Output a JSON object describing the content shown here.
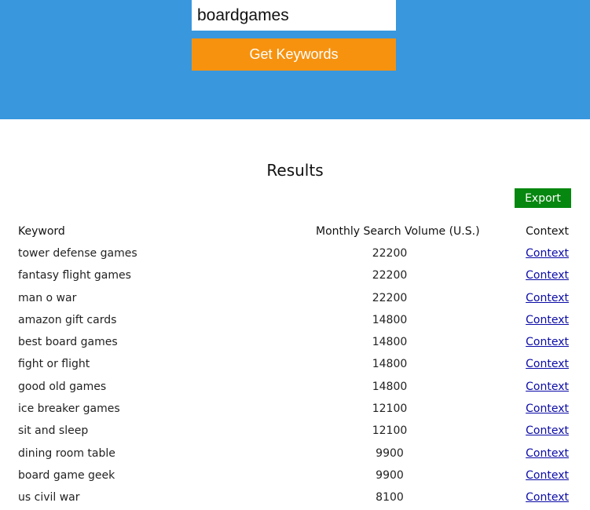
{
  "search": {
    "value": "boardgames",
    "button_label": "Get Keywords"
  },
  "results": {
    "title": "Results",
    "export_label": "Export",
    "columns": {
      "keyword": "Keyword",
      "volume": "Monthly Search Volume (U.S.)",
      "context": "Context"
    },
    "rows": [
      {
        "keyword": "tower defense games",
        "volume": "22200",
        "context": "Context"
      },
      {
        "keyword": "fantasy flight games",
        "volume": "22200",
        "context": "Context"
      },
      {
        "keyword": "man o war",
        "volume": "22200",
        "context": "Context"
      },
      {
        "keyword": "amazon gift cards",
        "volume": "14800",
        "context": "Context"
      },
      {
        "keyword": "best board games",
        "volume": "14800",
        "context": "Context"
      },
      {
        "keyword": "fight or flight",
        "volume": "14800",
        "context": "Context"
      },
      {
        "keyword": "good old games",
        "volume": "14800",
        "context": "Context"
      },
      {
        "keyword": "ice breaker games",
        "volume": "12100",
        "context": "Context"
      },
      {
        "keyword": "sit and sleep",
        "volume": "12100",
        "context": "Context"
      },
      {
        "keyword": "dining room table",
        "volume": "9900",
        "context": "Context"
      },
      {
        "keyword": "board game geek",
        "volume": "9900",
        "context": "Context"
      },
      {
        "keyword": "us civil war",
        "volume": "8100",
        "context": "Context"
      }
    ]
  },
  "colors": {
    "hero_background": "#3897dd",
    "primary_button": "#f7920f",
    "export_button": "#06870f",
    "link": "#0a0aa8"
  }
}
